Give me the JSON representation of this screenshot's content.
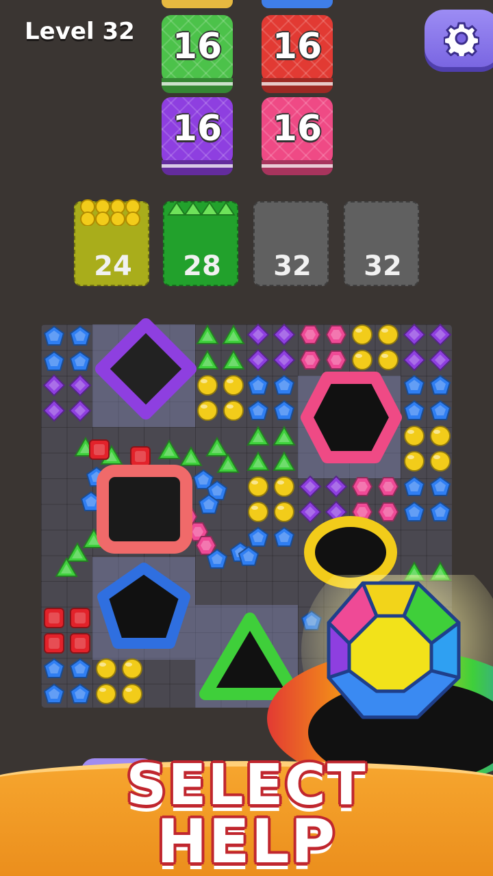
{
  "hud": {
    "level_label": "Level 32",
    "settings_icon": "gear-icon"
  },
  "targets": [
    {
      "value": "16",
      "color": "#4cc24a"
    },
    {
      "value": "16",
      "color": "#e23a33"
    },
    {
      "value": "16",
      "color": "#8e3fe0"
    },
    {
      "value": "16",
      "color": "#ef4a85"
    }
  ],
  "slots": [
    {
      "count": "24",
      "color": "#a9ad1b",
      "gem": "yellow-circle-gem",
      "filled": true
    },
    {
      "count": "28",
      "color": "#22a12c",
      "gem": "green-triangle-gem",
      "filled": true
    },
    {
      "count": "32",
      "color": "#606060",
      "gem": "",
      "filled": false
    },
    {
      "count": "32",
      "color": "#606060",
      "gem": "",
      "filled": false
    }
  ],
  "gem_colors": {
    "blue": "#2f7ef2",
    "purple": "#8e3fe0",
    "green": "#3fd13c",
    "yellow": "#f2cc1a",
    "pink": "#ef4a96",
    "red": "#e2222a"
  },
  "holes": [
    {
      "shape": "diamond",
      "color": "#8e3fe0"
    },
    {
      "shape": "hexagon",
      "color": "#ef4a85"
    },
    {
      "shape": "square",
      "color": "#f06a6a"
    },
    {
      "shape": "circle",
      "color": "#f2cc1a"
    },
    {
      "shape": "pentagon",
      "color": "#2f6fe0"
    },
    {
      "shape": "triangle",
      "color": "#3fcf3a"
    }
  ],
  "booster": {
    "icon": "rainbow-gem-icon"
  },
  "banner": {
    "line1": "SELECT",
    "line2": "HELP"
  }
}
